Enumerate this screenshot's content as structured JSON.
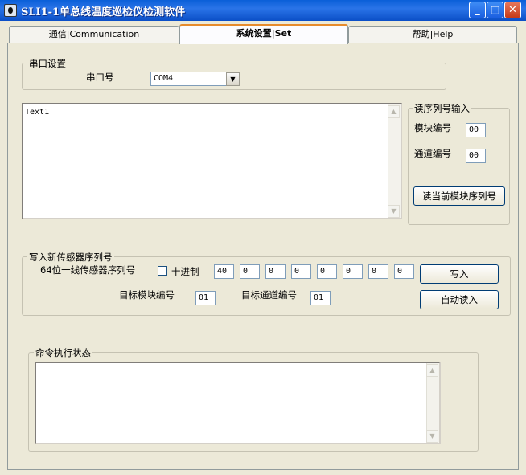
{
  "window": {
    "title": "SLI1-1单总线温度巡检仪检测软件",
    "minimize": "_",
    "maximize": "□",
    "close": "✕"
  },
  "tabs": [
    {
      "label": "通信|Communication"
    },
    {
      "label": "系统设置|Set"
    },
    {
      "label": "帮助|Help"
    }
  ],
  "serial": {
    "group_label": "串口设置",
    "port_label": "串口号",
    "port_value": "COM4"
  },
  "main_text": {
    "value": "Text1"
  },
  "read_serial": {
    "group_label": "读序列号输入",
    "module_label": "模块编号",
    "module_value": "00",
    "channel_label": "通道编号",
    "channel_value": "00",
    "read_button": "读当前模块序列号"
  },
  "write_sensor": {
    "group_label": "写入新传感器序列号",
    "serial_label": "64位一线传感器序列号",
    "decimal_label": "十进制",
    "bytes": [
      "40",
      "0",
      "0",
      "0",
      "0",
      "0",
      "0",
      "0"
    ],
    "target_module_label": "目标模块编号",
    "target_module_value": "01",
    "target_channel_label": "目标通道编号",
    "target_channel_value": "01",
    "write_button": "写入",
    "auto_read_button": "自动读入"
  },
  "status": {
    "group_label": "命令执行状态"
  },
  "scroll": {
    "up": "▲",
    "down": "▼",
    "combo": "▼"
  },
  "colors": {
    "titlebar": "#0a5fd8",
    "panel": "#ece9d8",
    "active_tab_accent": "#e68b2c"
  }
}
